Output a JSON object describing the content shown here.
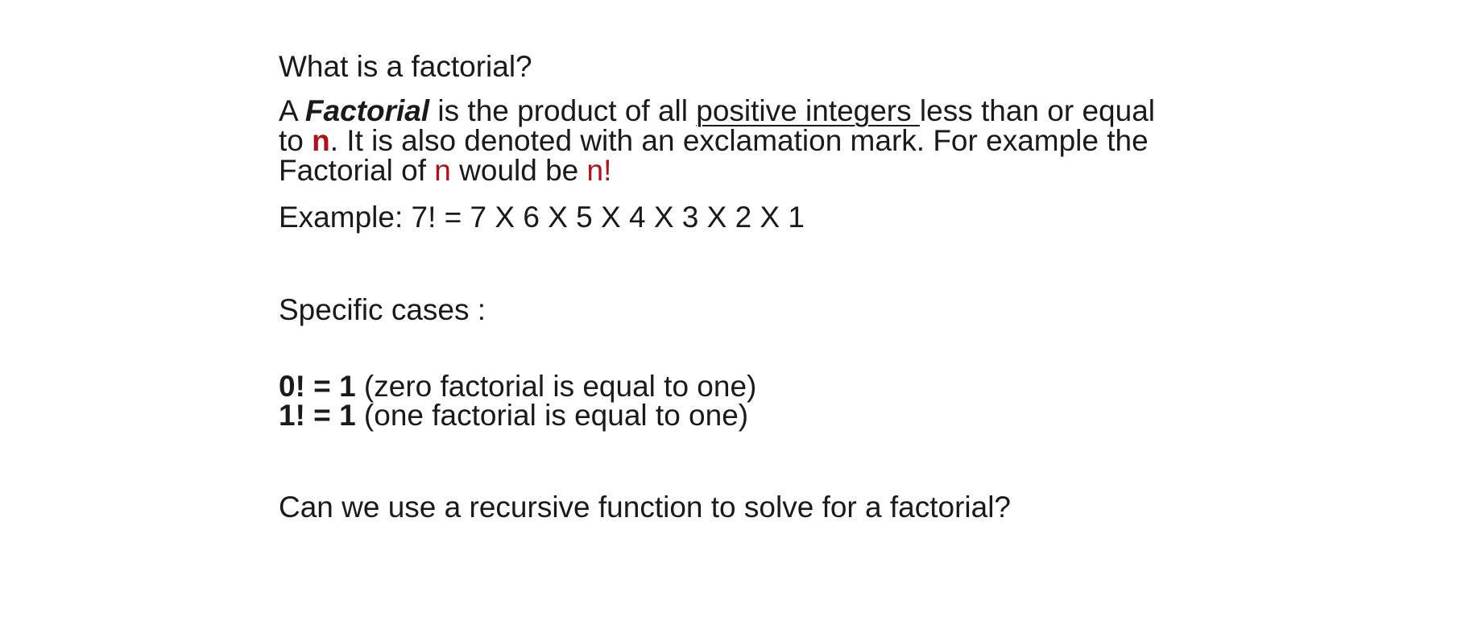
{
  "question_1": "What is a factorial?",
  "definition": {
    "article": "A ",
    "term": "Factorial",
    "text_a": " is the product of all ",
    "link_text": "positive integers ",
    "text_b": "less than or equal",
    "line2_prefix": "to ",
    "var_n": "n",
    "line2_rest": ". It is also denoted with an exclamation mark. For example the",
    "line3_prefix": "Factorial of ",
    "line3_n": "n",
    "line3_mid": " would be ",
    "line3_nfact": "n!"
  },
  "example": "Example: 7! = 7 X 6 X 5 X 4 X 3 X 2 X 1",
  "specific_cases_label": "Specific cases :",
  "cases": [
    {
      "formula": "0! = 1",
      "note": " (zero factorial is equal to one)"
    },
    {
      "formula": "1! = 1",
      "note": " (one factorial is equal to one)"
    }
  ],
  "question_2": "Can we use a recursive function to solve for a factorial?",
  "colors": {
    "text": "#1a1a1a",
    "highlight": "#b0111b"
  }
}
